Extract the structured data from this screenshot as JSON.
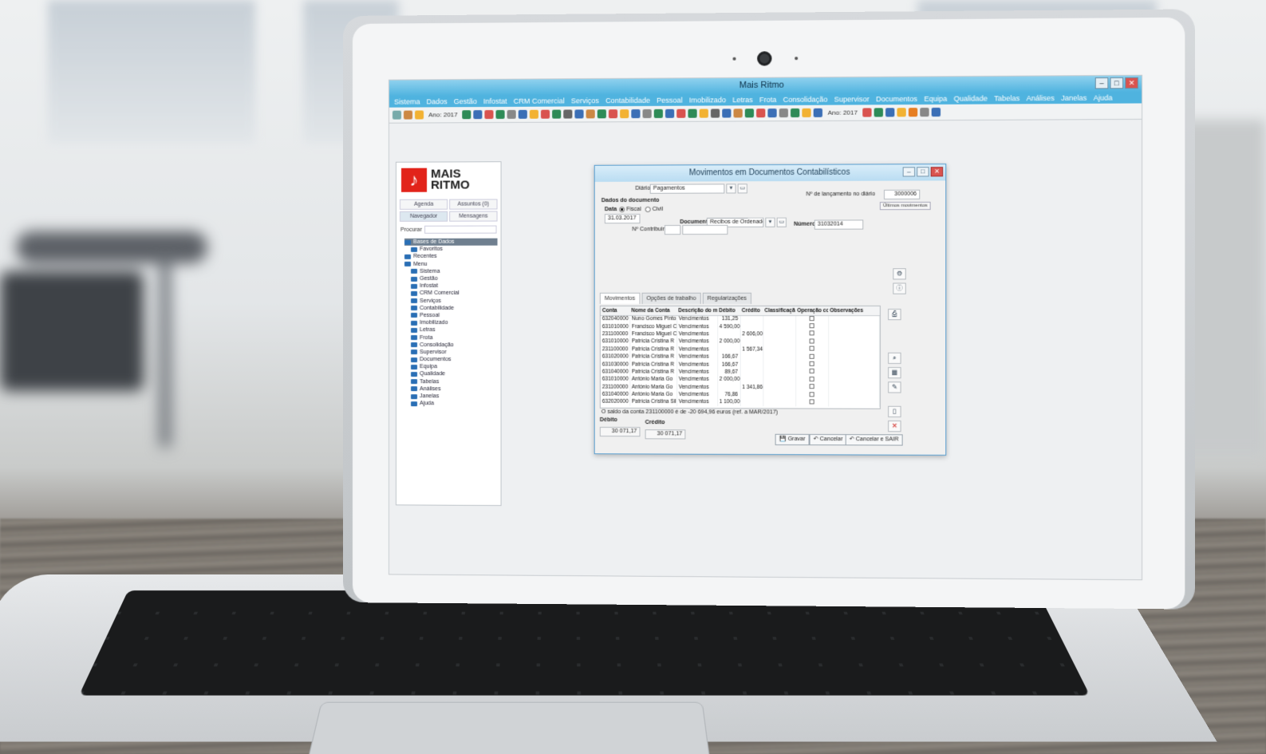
{
  "app": {
    "window_title": "Mais Ritmo",
    "menu": [
      "Sistema",
      "Dados",
      "Gestão",
      "Infostat",
      "CRM Comercial",
      "Serviços",
      "Contabilidade",
      "Pessoal",
      "Imobilizado",
      "Letras",
      "Frota",
      "Consolidação",
      "Supervisor",
      "Documentos",
      "Equipa",
      "Qualidade",
      "Tabelas",
      "Análises",
      "Janelas",
      "Ajuda"
    ],
    "toolbar_year_1": "Ano: 2017",
    "toolbar_year_2": "Ano: 2017"
  },
  "navigator": {
    "logo_line1": "MAIS",
    "logo_line2": "RITMO",
    "tabs": [
      "Agenda",
      "Assuntos (0)",
      "Navegador",
      "Mensagens"
    ],
    "search_label": "Procurar",
    "tree": [
      "Bases de Dados",
      "Favoritos",
      "Recentes",
      "Menu",
      "Sistema",
      "Gestão",
      "Infostat",
      "CRM Comercial",
      "Serviços",
      "Contabilidade",
      "Pessoal",
      "Imobilizado",
      "Letras",
      "Frota",
      "Consolidação",
      "Supervisor",
      "Documentos",
      "Equipa",
      "Qualidade",
      "Tabelas",
      "Análises",
      "Janelas",
      "Ajuda"
    ]
  },
  "dialog": {
    "title": "Movimentos em Documentos Contabilísticos",
    "diario_label": "Diário",
    "diario_value": "Pagamentos",
    "lancamento_label": "Nº de lançamento no diário",
    "lancamento_value": "3000006",
    "dados_label": "Dados do documento",
    "ultimos_button": "Últimos movimentos",
    "data_label": "Data",
    "fiscal_label": "Fiscal",
    "civil_label": "Civil",
    "data_value": "31.03.2017",
    "documento_label": "Documento",
    "documento_value": "Recibos de Ordenados",
    "numero_label": "Número",
    "numero_value": "31032014",
    "contribuinte_label": "Nº Contribuinte",
    "tabs": [
      "Movimentos",
      "Opções de trabalho",
      "Regularizações"
    ],
    "columns": [
      "Conta",
      "Nome da Conta",
      "Descrição do movimento",
      "Débito",
      "Crédito",
      "Classificação Estatística",
      "Operação com o e",
      "Observações"
    ],
    "rows": [
      {
        "conta": "632040000",
        "nome": "Nuno Gomes Pinto",
        "desc": "Vencimentos",
        "debito": "131,25",
        "credito": ""
      },
      {
        "conta": "631010000",
        "nome": "Francisco Miguel C",
        "desc": "Vencimentos",
        "debito": "4 590,00",
        "credito": ""
      },
      {
        "conta": "231100000",
        "nome": "Francisco Miguel C",
        "desc": "Vencimentos",
        "debito": "",
        "credito": "2 606,00"
      },
      {
        "conta": "631010000",
        "nome": "Patrícia Cristina R",
        "desc": "Vencimentos",
        "debito": "2 000,00",
        "credito": ""
      },
      {
        "conta": "231100000",
        "nome": "Patrícia Cristina R",
        "desc": "Vencimentos",
        "debito": "",
        "credito": "1 567,34"
      },
      {
        "conta": "631020000",
        "nome": "Patrícia Cristina R",
        "desc": "Vencimentos",
        "debito": "166,67",
        "credito": ""
      },
      {
        "conta": "631030000",
        "nome": "Patrícia Cristina R",
        "desc": "Vencimentos",
        "debito": "166,67",
        "credito": ""
      },
      {
        "conta": "631040000",
        "nome": "Patrícia Cristina R",
        "desc": "Vencimentos",
        "debito": "89,67",
        "credito": ""
      },
      {
        "conta": "631010000",
        "nome": "António Maria Go",
        "desc": "Vencimentos",
        "debito": "2 000,00",
        "credito": ""
      },
      {
        "conta": "231100000",
        "nome": "António Maria Go",
        "desc": "Vencimentos",
        "debito": "",
        "credito": "1 341,86"
      },
      {
        "conta": "631040000",
        "nome": "António Maria Go",
        "desc": "Vencimentos",
        "debito": "76,86",
        "credito": ""
      },
      {
        "conta": "632020000",
        "nome": "Patrícia Cristina Sil",
        "desc": "Vencimentos",
        "debito": "1 100,00",
        "credito": ""
      }
    ],
    "status_text": "O saldo da conta 231100000 é de -20 694,96 euros (ref. a MAR/2017)",
    "debito_label": "Débito",
    "credito_label": "Crédito",
    "debito_total": "30 071,17",
    "credito_total": "30 071,17",
    "btn_gravar": "Gravar",
    "btn_cancelar": "Cancelar",
    "btn_cancelar_sair": "Cancelar e SAIR"
  },
  "colors": {
    "title_blue": "#4fb3df",
    "logo_red": "#e2231a"
  }
}
